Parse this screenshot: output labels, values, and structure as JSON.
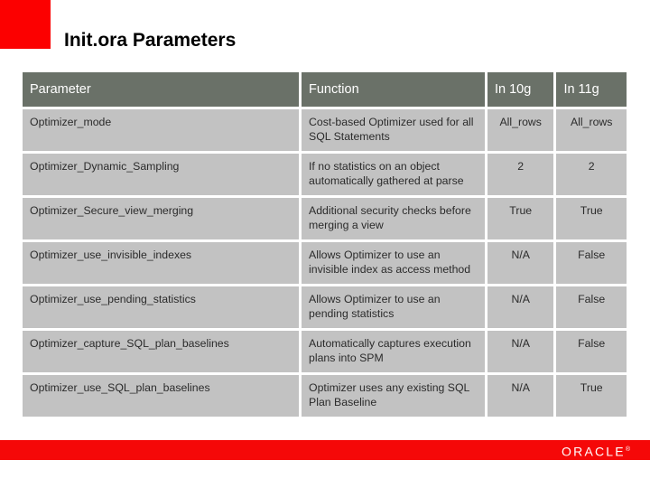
{
  "slide": {
    "title": "Init.ora Parameters",
    "accent_red": "#fc0000",
    "header_band": "#6a7168",
    "cell_bg": "#c2c2c2"
  },
  "footer": {
    "brand": "ORACLE",
    "trademark": "®",
    "bar_color": "#f50808"
  },
  "table": {
    "columns": [
      {
        "key": "parameter",
        "label": "Parameter"
      },
      {
        "key": "function",
        "label": "Function"
      },
      {
        "key": "in10g",
        "label": "In 10g"
      },
      {
        "key": "in11g",
        "label": "In 11g"
      }
    ],
    "rows": [
      {
        "parameter": "Optimizer_mode",
        "function": "Cost-based Optimizer used for all SQL Statements",
        "in10g": "All_rows",
        "in11g": "All_rows"
      },
      {
        "parameter": "Optimizer_Dynamic_Sampling",
        "function": "If no statistics on an object automatically gathered at parse",
        "in10g": "2",
        "in11g": "2"
      },
      {
        "parameter": "Optimizer_Secure_view_merging",
        "function": "Additional security checks before merging a view",
        "in10g": "True",
        "in11g": "True"
      },
      {
        "parameter": "Optimizer_use_invisible_indexes",
        "function": "Allows Optimizer to use an invisible index as access method",
        "in10g": "N/A",
        "in11g": "False"
      },
      {
        "parameter": "Optimizer_use_pending_statistics",
        "function": "Allows Optimizer to use an pending statistics",
        "in10g": "N/A",
        "in11g": "False"
      },
      {
        "parameter": "Optimizer_capture_SQL_plan_baselines",
        "function": "Automatically captures execution plans into SPM",
        "in10g": "N/A",
        "in11g": "False"
      },
      {
        "parameter": "Optimizer_use_SQL_plan_baselines",
        "function": "Optimizer uses any existing SQL Plan Baseline",
        "in10g": "N/A",
        "in11g": "True"
      }
    ]
  }
}
